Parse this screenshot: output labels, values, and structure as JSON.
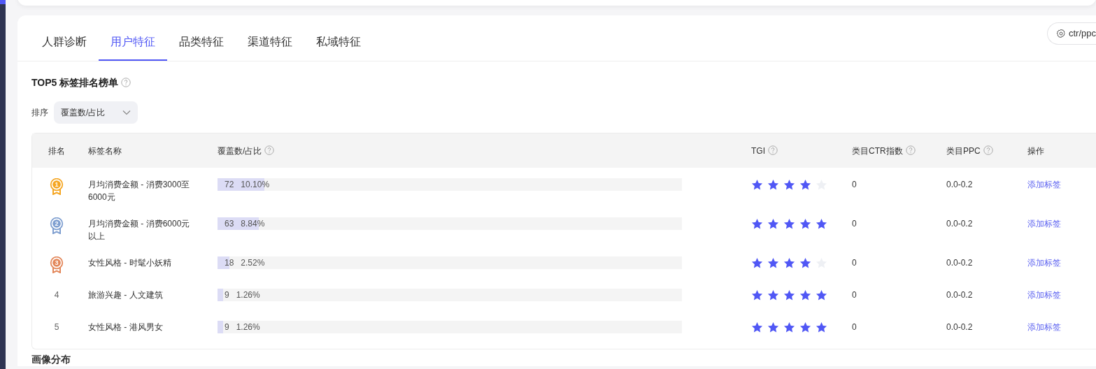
{
  "tabs": [
    {
      "label": "人群诊断",
      "selected": false
    },
    {
      "label": "用户特征",
      "selected": true
    },
    {
      "label": "品类特征",
      "selected": false
    },
    {
      "label": "渠道特征",
      "selected": false
    },
    {
      "label": "私域特征",
      "selected": false
    }
  ],
  "settings_button": {
    "label": "ctr/ppc"
  },
  "ranking": {
    "title": "TOP5 标签排名榜单",
    "help": true,
    "sort": {
      "label": "排序",
      "value": "覆盖数/占比"
    },
    "table": {
      "columns": [
        {
          "label": "排名",
          "help": false
        },
        {
          "label": "标签名称",
          "help": false
        },
        {
          "label": "覆盖数/占比",
          "help": true
        },
        {
          "label": "TGI",
          "help": true
        },
        {
          "label": "类目CTR指数",
          "help": true
        },
        {
          "label": "类目PPC",
          "help": true
        },
        {
          "label": "操作",
          "help": false
        }
      ],
      "rows": [
        {
          "rank": "1",
          "kind": "medal",
          "color": "#f5a623",
          "name": "月均消费金额 - 消费3000至6000元",
          "count": "72",
          "percent": "10.10%",
          "level": 0.101,
          "stars": 4,
          "ctr_index": "0",
          "ppc": "0.0-0.2",
          "action": "添加标签"
        },
        {
          "rank": "2",
          "kind": "medal",
          "color": "#7f9fd0",
          "name": "月均消费金额 - 消费6000元以上",
          "count": "63",
          "percent": "8.84%",
          "level": 0.0884,
          "stars": 5,
          "ctr_index": "0",
          "ppc": "0.0-0.2",
          "action": "添加标签"
        },
        {
          "rank": "3",
          "kind": "medal",
          "color": "#e3875a",
          "name": "女性风格 - 时髦小妖精",
          "count": "18",
          "percent": "2.52%",
          "level": 0.0252,
          "stars": 4,
          "ctr_index": "0",
          "ppc": "0.0-0.2",
          "action": "添加标签"
        },
        {
          "rank": "4",
          "kind": "number",
          "name": "旅游兴趣 - 人文建筑",
          "count": "9",
          "percent": "1.26%",
          "level": 0.0126,
          "stars": 5,
          "ctr_index": "0",
          "ppc": "0.0-0.2",
          "action": "添加标签"
        },
        {
          "rank": "5",
          "kind": "number",
          "name": "女性风格 - 港风男女",
          "count": "9",
          "percent": "1.26%",
          "level": 0.0126,
          "stars": 5,
          "ctr_index": "0",
          "ppc": "0.0-0.2",
          "action": "添加标签"
        }
      ]
    }
  },
  "next_section": {
    "title": "画像分布"
  }
}
